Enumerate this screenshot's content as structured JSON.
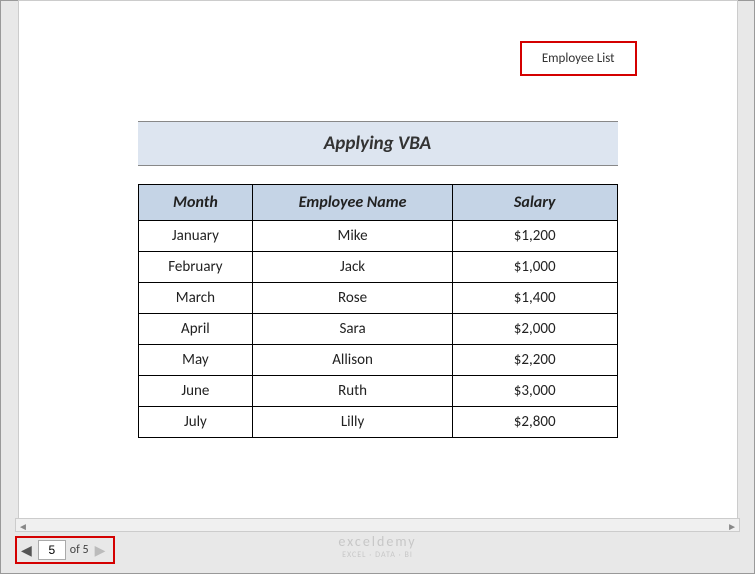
{
  "header": {
    "label": "Employee List"
  },
  "title": "Applying VBA",
  "table": {
    "headers": [
      "Month",
      "Employee Name",
      "Salary"
    ],
    "rows": [
      {
        "month": "January",
        "name": "Mike",
        "salary": "$1,200"
      },
      {
        "month": "February",
        "name": "Jack",
        "salary": "$1,000"
      },
      {
        "month": "March",
        "name": "Rose",
        "salary": "$1,400"
      },
      {
        "month": "April",
        "name": "Sara",
        "salary": "$2,000"
      },
      {
        "month": "May",
        "name": "Allison",
        "salary": "$2,200"
      },
      {
        "month": "June",
        "name": "Ruth",
        "salary": "$3,000"
      },
      {
        "month": "July",
        "name": "Lilly",
        "salary": "$2,800"
      }
    ]
  },
  "pagination": {
    "current": "5",
    "total": "5",
    "of_label": "of"
  },
  "watermark": {
    "main": "exceldemy",
    "sub": "EXCEL · DATA · BI"
  }
}
